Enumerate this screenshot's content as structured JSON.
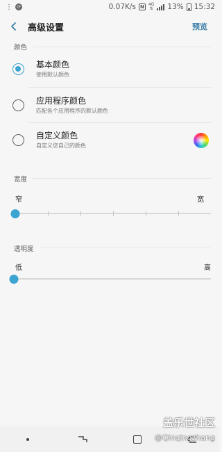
{
  "status_bar": {
    "speed": "0.07K/s",
    "network_type": "4G",
    "battery": "13%",
    "time": "15:32",
    "icons": [
      "carrier-icon",
      "sync-icon",
      "nfc-icon",
      "network-icon",
      "signal-icon",
      "battery-icon"
    ]
  },
  "header": {
    "title": "高级设置",
    "preview_label": "预览"
  },
  "color_section": {
    "header": "颜色",
    "options": [
      {
        "title": "基本颜色",
        "subtitle": "使用默认颜色",
        "selected": true
      },
      {
        "title": "应用程序颜色",
        "subtitle": "匹配各个应用程序的默认颜色",
        "selected": false
      },
      {
        "title": "自定义颜色",
        "subtitle": "自定义您自己的颜色",
        "selected": false
      }
    ]
  },
  "width_section": {
    "header": "宽度",
    "min_label": "窄",
    "max_label": "宽",
    "value": 0,
    "steps": 6
  },
  "transparency_section": {
    "header": "透明度",
    "min_label": "低",
    "max_label": "高",
    "value": 0
  },
  "watermark": {
    "brand": "盖乐世社区",
    "user": "@Qinqingzhang"
  },
  "nav_bar": {
    "buttons": [
      "dot",
      "recents",
      "home",
      "back"
    ]
  },
  "colors": {
    "accent": "#3ba4d1",
    "preview_text": "#3a7da6",
    "background": "#f6f6f6"
  }
}
